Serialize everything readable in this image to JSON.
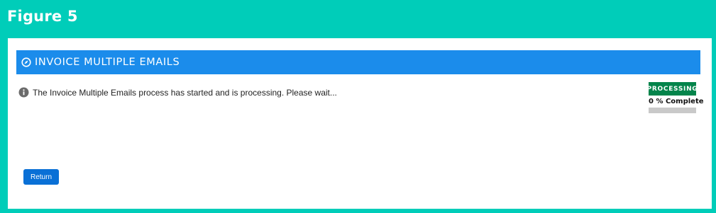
{
  "figure": {
    "title": "Figure 5"
  },
  "panel": {
    "title": "INVOICE MULTIPLE EMAILS",
    "icon": "compass-icon",
    "header_color": "#1B8CEB"
  },
  "message": {
    "icon": "info-icon",
    "text": "The Invoice Multiple Emails process has started and is processing. Please wait..."
  },
  "status": {
    "badge": "PROCESSING",
    "badge_color": "#04844B",
    "progress_text": "0 % Complete",
    "progress_percent": 0
  },
  "actions": {
    "return_label": "Return"
  },
  "colors": {
    "frame": "#00CDB9",
    "button": "#0A70D6"
  }
}
